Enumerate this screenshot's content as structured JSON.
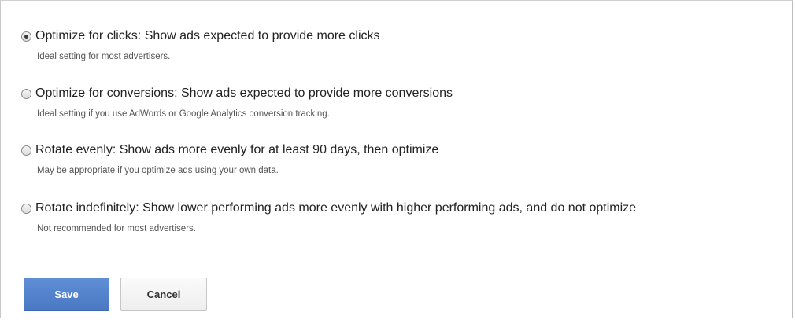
{
  "options": [
    {
      "label": "Optimize for clicks: Show ads expected to provide more clicks",
      "description": "Ideal setting for most advertisers.",
      "selected": true
    },
    {
      "label": "Optimize for conversions: Show ads expected to provide more conversions",
      "description": "Ideal setting if you use AdWords or Google Analytics conversion tracking.",
      "selected": false
    },
    {
      "label": "Rotate evenly: Show ads more evenly for at least 90 days, then optimize",
      "description": "May be appropriate if you optimize ads using your own data.",
      "selected": false
    },
    {
      "label": "Rotate indefinitely: Show lower performing ads more evenly with higher performing ads, and do not optimize",
      "description": "Not recommended for most advertisers.",
      "selected": false
    }
  ],
  "buttons": {
    "save_label": "Save",
    "cancel_label": "Cancel"
  },
  "colors": {
    "save_button": "#4a78c4",
    "text": "#222222",
    "description_text": "#555555"
  }
}
